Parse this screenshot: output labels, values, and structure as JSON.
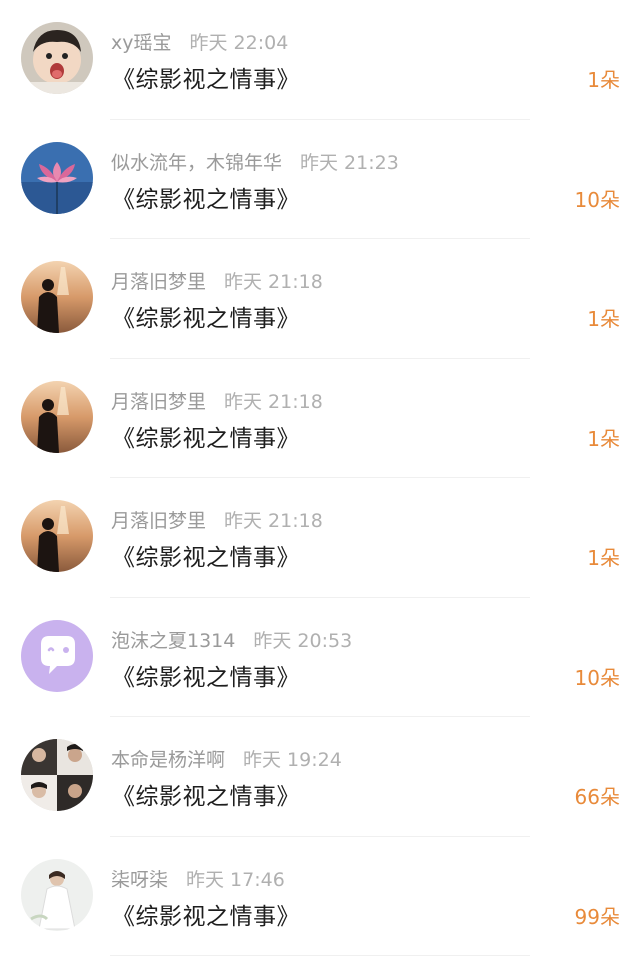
{
  "entries": [
    {
      "user": "xy瑶宝",
      "time": "昨天 22:04",
      "book": "《综影视之情事》",
      "gift": "1朵",
      "avatar": "child-avatar"
    },
    {
      "user": "似水流年，木锦年华",
      "time": "昨天 21:23",
      "book": "《综影视之情事》",
      "gift": "10朵",
      "avatar": "lotus-avatar"
    },
    {
      "user": "月落旧梦里",
      "time": "昨天 21:18",
      "book": "《综影视之情事》",
      "gift": "1朵",
      "avatar": "sunset-girl-avatar"
    },
    {
      "user": "月落旧梦里",
      "time": "昨天 21:18",
      "book": "《综影视之情事》",
      "gift": "1朵",
      "avatar": "sunset-girl-avatar"
    },
    {
      "user": "月落旧梦里",
      "time": "昨天 21:18",
      "book": "《综影视之情事》",
      "gift": "1朵",
      "avatar": "sunset-girl-avatar"
    },
    {
      "user": "泡沫之夏1314",
      "time": "昨天 20:53",
      "book": "《综影视之情事》",
      "gift": "10朵",
      "avatar": "chat-bubble-avatar"
    },
    {
      "user": "本命是杨洋啊",
      "time": "昨天 19:24",
      "book": "《综影视之情事》",
      "gift": "66朵",
      "avatar": "collage-avatar"
    },
    {
      "user": "柒呀柒",
      "time": "昨天 17:46",
      "book": "《综影视之情事》",
      "gift": "99朵",
      "avatar": "white-dress-avatar"
    }
  ],
  "colors": {
    "gift": "#e88a3a",
    "meta": "#9a9a9a",
    "title": "#1e1e1e"
  }
}
